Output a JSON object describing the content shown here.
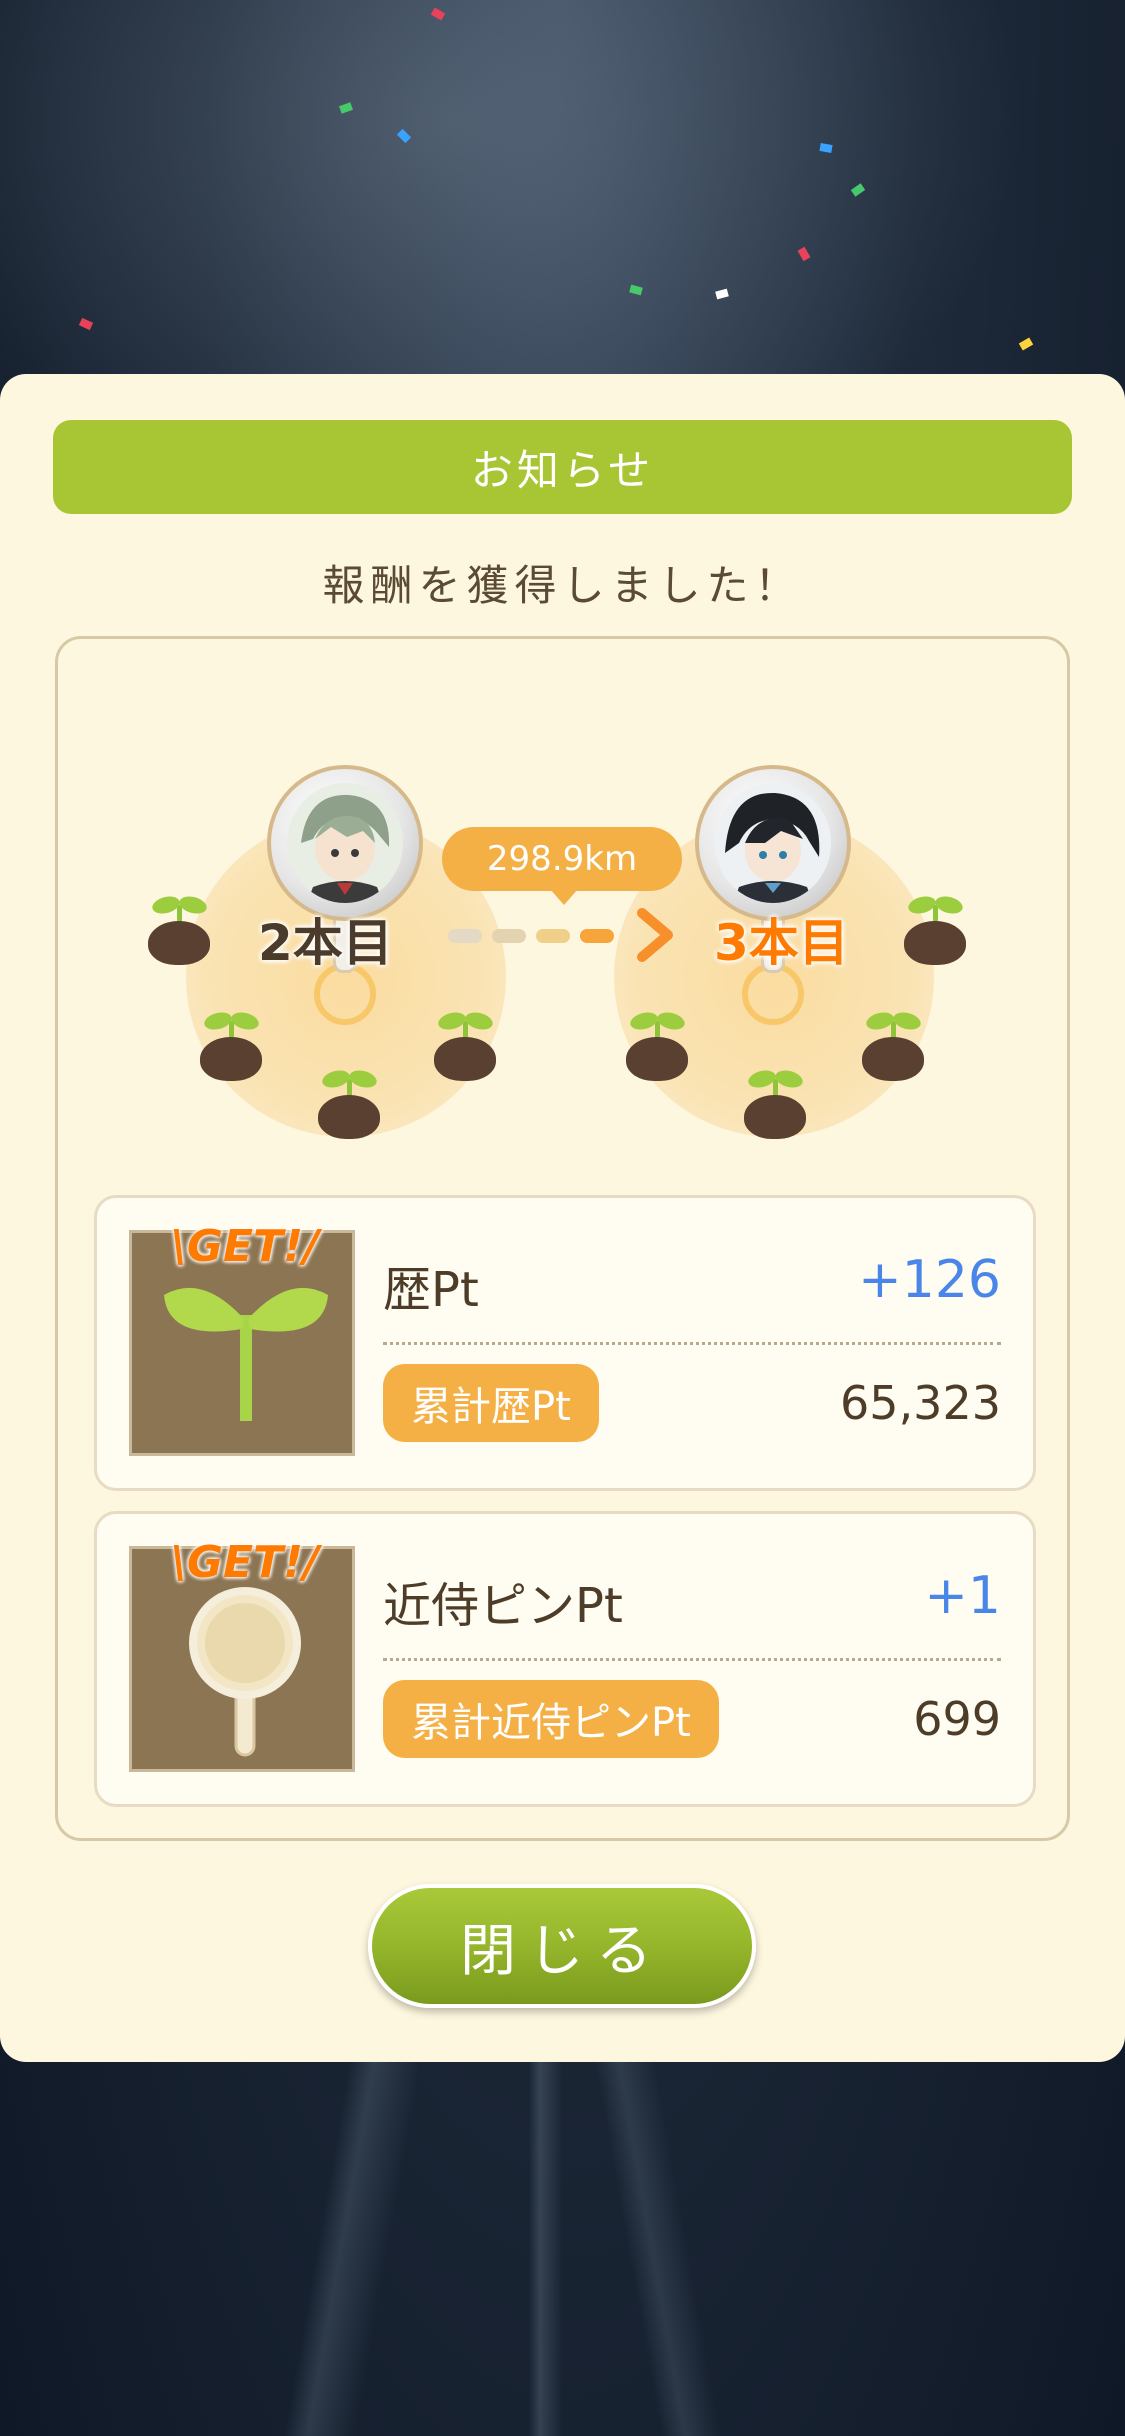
{
  "dialog": {
    "title": "お知らせ",
    "message": "報酬を獲得しました！",
    "close_label": "閉じる"
  },
  "progress": {
    "from_label": "2本目",
    "to_label": "3本目",
    "distance": "298.9km"
  },
  "rewards": [
    {
      "badge": "\\GET!/",
      "icon": "sprout-icon",
      "title": "歴Pt",
      "gain": "+126",
      "total_label": "累計歴Pt",
      "total_value": "65,323"
    },
    {
      "badge": "\\GET!/",
      "icon": "pin-icon",
      "title": "近侍ピンPt",
      "gain": "+1",
      "total_label": "累計近侍ピンPt",
      "total_value": "699"
    }
  ],
  "colors": {
    "title_bar": "#a8c634",
    "panel": "#fdf7df",
    "pill": "#f4b045",
    "gain_text": "#4a86e8",
    "get_badge": "#ff7a00",
    "next_label": "#ff7a00"
  }
}
